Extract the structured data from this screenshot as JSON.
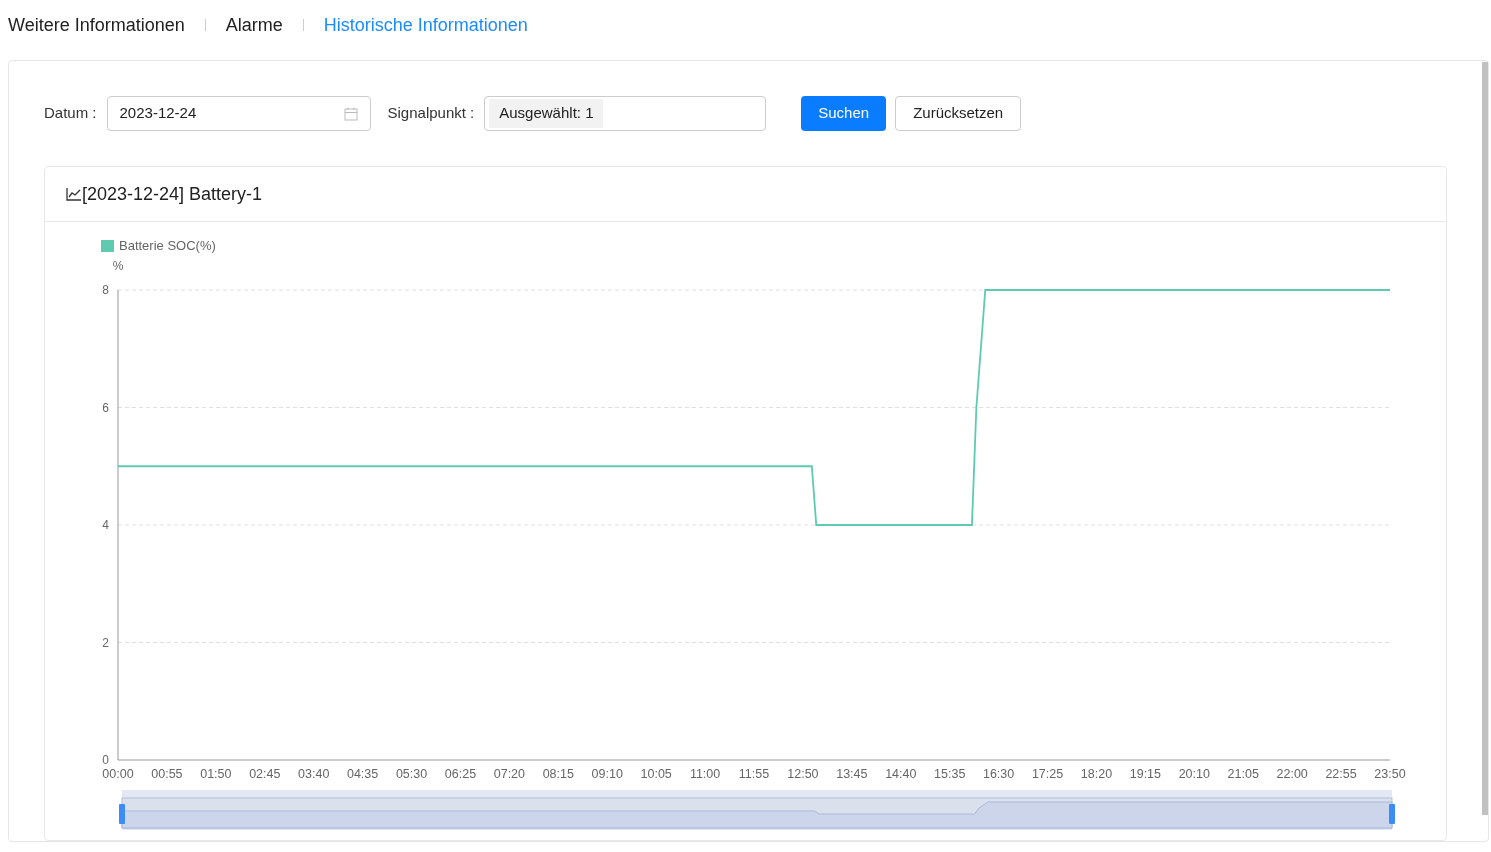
{
  "tabs": [
    {
      "label": "Weitere Informationen",
      "selected": false
    },
    {
      "label": "Alarme",
      "selected": false
    },
    {
      "label": "Historische Informationen",
      "selected": true
    }
  ],
  "filters": {
    "date_label": "Datum :",
    "date_value": "2023-12-24",
    "signal_label": "Signalpunkt :",
    "signal_tag": "Ausgewählt: 1"
  },
  "buttons": [
    {
      "label": "Suchen",
      "kind": "primary"
    },
    {
      "label": "Zurücksetzen",
      "kind": "default"
    }
  ],
  "chart_card": {
    "title": "[2023-12-24] Battery-1",
    "chart_data": {
      "type": "line",
      "ylabel": "%",
      "x": [
        0,
        780,
        785,
        960,
        965,
        975,
        1430
      ],
      "series": [
        {
          "name": "Batterie SOC(%)",
          "color": "#5ecbb0",
          "values": [
            5,
            5,
            4,
            4,
            6,
            8,
            8
          ]
        }
      ],
      "grid": true,
      "xlim": [
        0,
        1430
      ],
      "ylim": [
        0,
        8
      ],
      "yticks": [
        0,
        2,
        4,
        6,
        8
      ],
      "xticks": [
        {
          "value": 0,
          "label": "00:00"
        },
        {
          "value": 55,
          "label": "00:55"
        },
        {
          "value": 110,
          "label": "01:50"
        },
        {
          "value": 165,
          "label": "02:45"
        },
        {
          "value": 220,
          "label": "03:40"
        },
        {
          "value": 275,
          "label": "04:35"
        },
        {
          "value": 330,
          "label": "05:30"
        },
        {
          "value": 385,
          "label": "06:25"
        },
        {
          "value": 440,
          "label": "07:20"
        },
        {
          "value": 495,
          "label": "08:15"
        },
        {
          "value": 550,
          "label": "09:10"
        },
        {
          "value": 605,
          "label": "10:05"
        },
        {
          "value": 660,
          "label": "11:00"
        },
        {
          "value": 715,
          "label": "11:55"
        },
        {
          "value": 770,
          "label": "12:50"
        },
        {
          "value": 825,
          "label": "13:45"
        },
        {
          "value": 880,
          "label": "14:40"
        },
        {
          "value": 935,
          "label": "15:35"
        },
        {
          "value": 990,
          "label": "16:30"
        },
        {
          "value": 1045,
          "label": "17:25"
        },
        {
          "value": 1100,
          "label": "18:20"
        },
        {
          "value": 1155,
          "label": "19:15"
        },
        {
          "value": 1210,
          "label": "20:10"
        },
        {
          "value": 1265,
          "label": "21:05"
        },
        {
          "value": 1320,
          "label": "22:00"
        },
        {
          "value": 1375,
          "label": "22:55"
        },
        {
          "value": 1430,
          "label": "23:50"
        }
      ]
    }
  }
}
